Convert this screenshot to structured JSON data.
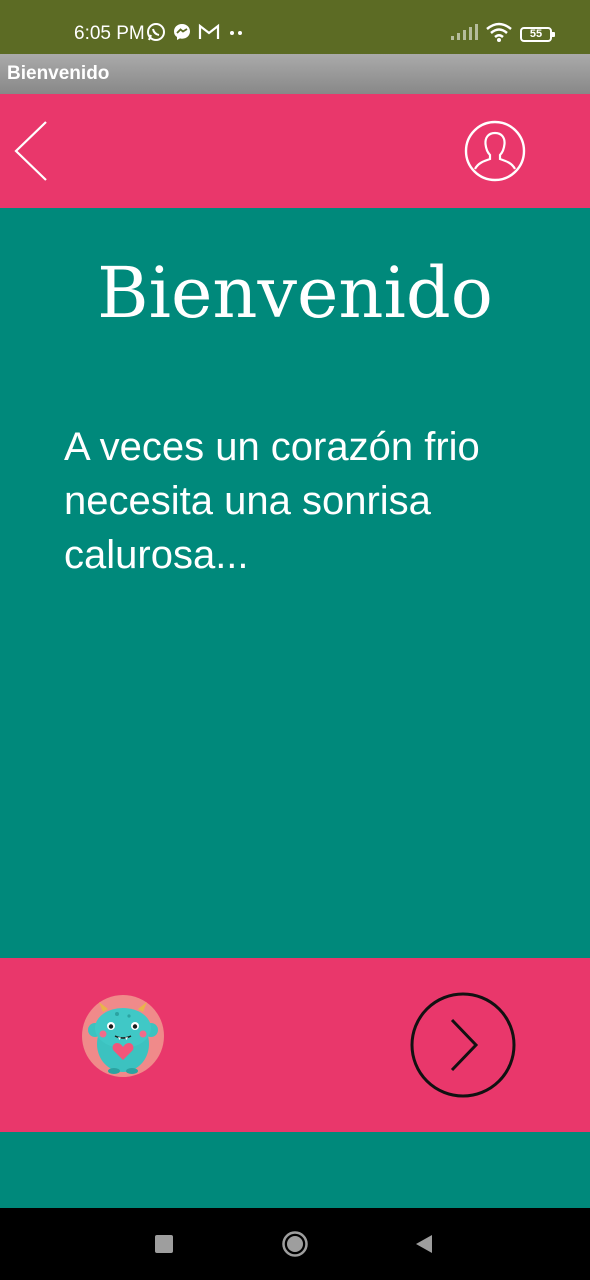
{
  "status_bar": {
    "time": "6:05 PM",
    "battery": "55",
    "background_color": "#5C6B24",
    "app_icons": [
      "whatsapp-icon",
      "messenger-icon",
      "gmail-icon",
      "more-dots-icon"
    ],
    "system_icons": [
      "signal-icon",
      "wifi-icon",
      "battery-icon"
    ]
  },
  "title_bar": {
    "title": "Bienvenido"
  },
  "top_bar": {
    "background_color": "#E9376B",
    "back_icon": "chevron-left-icon",
    "profile_icon": "user-profile-icon"
  },
  "main": {
    "title": "Bienvenido",
    "message": "A veces un corazón frio necesita una sonrisa calurosa...",
    "background_color": "#00897B"
  },
  "bottom_bar": {
    "background_color": "#E9376B",
    "mascot_icon": "monster-mascot-icon",
    "next_icon": "chevron-right-circle-icon"
  },
  "nav_bar": {
    "icons": [
      "recents-square-icon",
      "home-circle-icon",
      "back-triangle-icon"
    ]
  }
}
